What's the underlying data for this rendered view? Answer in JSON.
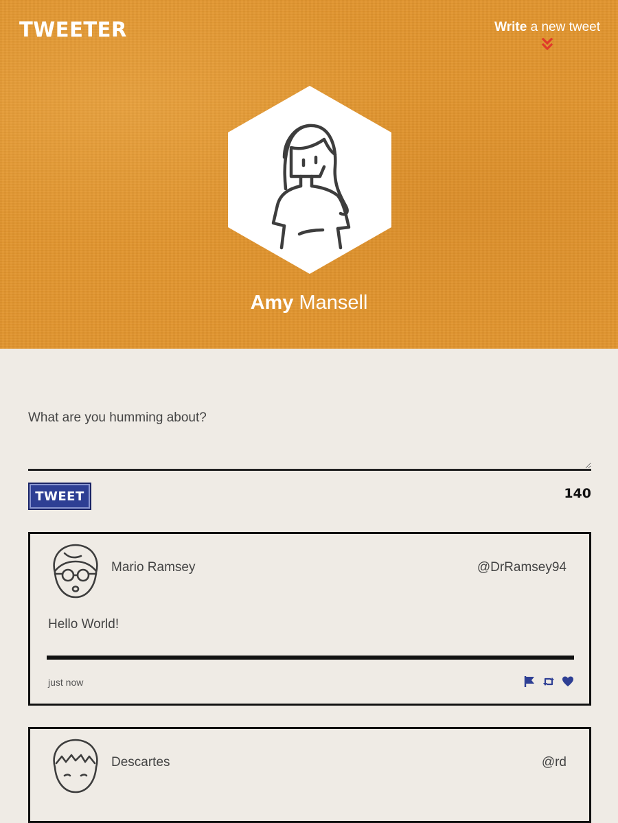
{
  "header": {
    "logo": "TWEETER",
    "write_nav": {
      "strong": "Write",
      "rest": " a new tweet",
      "icon": "double-chevron-down-icon"
    },
    "profile": {
      "first_name": "Amy",
      "last_name": "Mansell",
      "avatar_icon": "woman-avatar-icon"
    }
  },
  "compose": {
    "placeholder": "What are you humming about?",
    "value": "",
    "button_label": "TWEET",
    "char_count": "140"
  },
  "tweets": [
    {
      "name": "Mario Ramsey",
      "handle": "@DrRamsey94",
      "body": "Hello World!",
      "time": "just now",
      "avatar_icon": "man-with-glasses-avatar-icon",
      "actions": [
        "flag-icon",
        "retweet-icon",
        "heart-icon"
      ]
    },
    {
      "name": "Descartes",
      "handle": "@rd",
      "avatar_icon": "man-avatar-icon"
    }
  ],
  "colors": {
    "header_bg": "#e1952e",
    "page_bg": "#efebe5",
    "accent_blue": "#2e3f94",
    "chevron_red": "#e03a2a"
  }
}
